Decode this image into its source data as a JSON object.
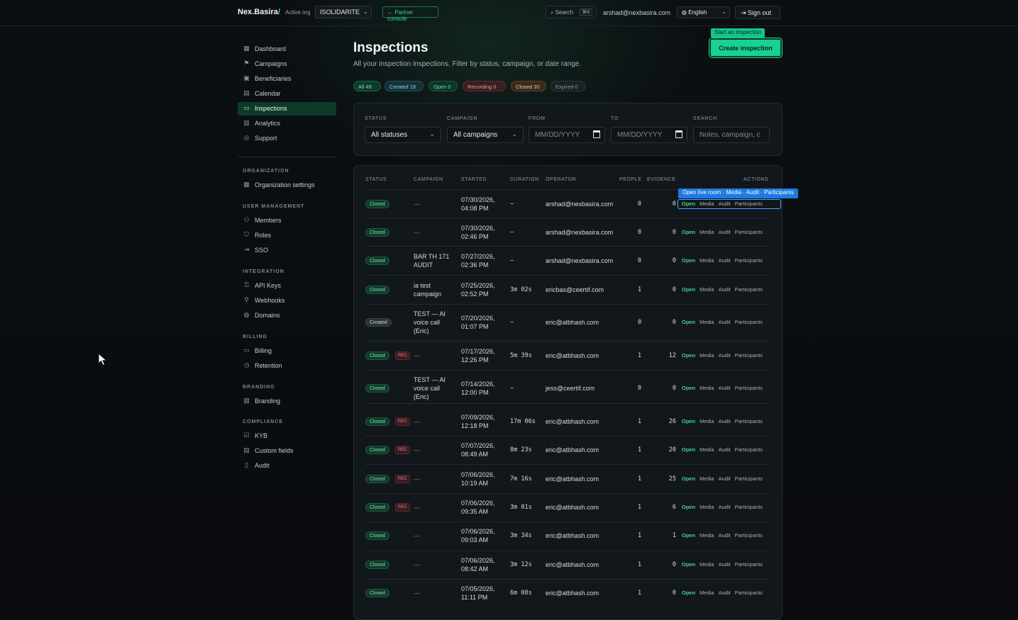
{
  "header": {
    "logo_text": "Nex.Basira",
    "logo_slash": "/",
    "active_org_label": "Active org",
    "org_name": "ISOLIDARITE",
    "partner_console": "← Partner console",
    "search_label": "Search",
    "search_kbd": "⌘K",
    "user_email": "arshad@nexbasira.com",
    "language": "English",
    "sign_out": "Sign out"
  },
  "sidebar": {
    "main": [
      {
        "label": "Dashboard",
        "icon": "dashboard-icon"
      },
      {
        "label": "Campaigns",
        "icon": "flag-icon"
      },
      {
        "label": "Beneficiaries",
        "icon": "id-card-icon"
      },
      {
        "label": "Calendar",
        "icon": "calendar-icon"
      },
      {
        "label": "Inspections",
        "icon": "video-icon",
        "active": true
      },
      {
        "label": "Analytics",
        "icon": "bar-chart-icon"
      },
      {
        "label": "Support",
        "icon": "life-buoy-icon"
      }
    ],
    "sections": [
      {
        "heading": "ORGANIZATION",
        "items": [
          "Organization settings"
        ]
      },
      {
        "heading": "USER MANAGEMENT",
        "items": [
          "Members",
          "Roles",
          "SSO"
        ]
      },
      {
        "heading": "INTEGRATION",
        "items": [
          "API Keys",
          "Webhooks",
          "Domains"
        ]
      },
      {
        "heading": "BILLING",
        "items": [
          "Billing",
          "Retention"
        ]
      },
      {
        "heading": "BRANDING",
        "items": [
          "Branding"
        ]
      },
      {
        "heading": "COMPLIANCE",
        "items": [
          "KYB",
          "Custom fields",
          "Audit"
        ]
      }
    ]
  },
  "page": {
    "title": "Inspections",
    "subtitle": "All your inspection inspections. Filter by status, campaign, or date range.",
    "start_tooltip": "Start an inspection",
    "create_button": "Create inspection"
  },
  "chips": [
    {
      "label": "All 49",
      "bg": "#0f3a29",
      "fg": "#7fe0b4",
      "border": "#1a6a48"
    },
    {
      "label": "Created 19",
      "bg": "#133238",
      "fg": "#8fd6e0",
      "border": "#235059"
    },
    {
      "label": "Open 0",
      "bg": "#0f3427",
      "fg": "#6fdcae",
      "border": "#1c5a41"
    },
    {
      "label": "Recording 0",
      "bg": "#3a1f20",
      "fg": "#e29a9a",
      "border": "#5a2e30"
    },
    {
      "label": "Closed 30",
      "bg": "#3a2a1a",
      "fg": "#e9c79a",
      "border": "#5a4228"
    },
    {
      "label": "Expired 0",
      "bg": "#1b2125",
      "fg": "#8c969e",
      "border": "#2c353c"
    }
  ],
  "filters": {
    "status_label": "STATUS",
    "status_value": "All statuses",
    "campaign_label": "CAMPAIGN",
    "campaign_value": "All campaigns",
    "from_label": "FROM",
    "from_placeholder": "MM/DD/YYYY",
    "to_label": "TO",
    "to_placeholder": "MM/DD/YYYY",
    "search_label": "SEARCH",
    "search_placeholder": "Notes, campaign, c"
  },
  "table": {
    "columns": [
      "STATUS",
      "CAMPAIGN",
      "STARTED",
      "DURATION",
      "OPERATOR",
      "PEOPLE",
      "EVIDENCE",
      "ACTIONS"
    ],
    "actions": [
      "Open",
      "Media",
      "Audit",
      "Participants"
    ],
    "focus_tooltip": "Open live room · Media · Audit · Participants",
    "rows": [
      {
        "status": "Closed",
        "rec": false,
        "campaign": [
          "—"
        ],
        "started": [
          "07/30/2026,",
          "04:08 PM"
        ],
        "duration": "—",
        "operator": "arshad@nexbasira.com",
        "people": "0",
        "evidence": "0"
      },
      {
        "status": "Closed",
        "rec": false,
        "campaign": [
          "—"
        ],
        "started": [
          "07/30/2026,",
          "02:46 PM"
        ],
        "duration": "—",
        "operator": "arshad@nexbasira.com",
        "people": "0",
        "evidence": "0"
      },
      {
        "status": "Closed",
        "rec": false,
        "campaign": [
          "BAR TH 171",
          "AUDIT"
        ],
        "started": [
          "07/27/2026,",
          "02:36 PM"
        ],
        "duration": "—",
        "operator": "arshad@nexbasira.com",
        "people": "0",
        "evidence": "0"
      },
      {
        "status": "Closed",
        "rec": false,
        "campaign": [
          "ia test",
          "campaign"
        ],
        "started": [
          "07/25/2026,",
          "02:52 PM"
        ],
        "duration": "3m 02s",
        "operator": "ericbas@ceertif.com",
        "people": "1",
        "evidence": "0"
      },
      {
        "status": "Created",
        "rec": false,
        "campaign": [
          "TEST — AI",
          "voice call",
          "(Eric)"
        ],
        "started": [
          "07/20/2026,",
          "01:07 PM"
        ],
        "duration": "—",
        "operator": "eric@atbhash.com",
        "people": "0",
        "evidence": "0"
      },
      {
        "status": "Closed",
        "rec": true,
        "campaign": [
          "—"
        ],
        "started": [
          "07/17/2026,",
          "12:26 PM"
        ],
        "duration": "5m 39s",
        "operator": "eric@atbhash.com",
        "people": "1",
        "evidence": "12"
      },
      {
        "status": "Closed",
        "rec": false,
        "campaign": [
          "TEST — AI",
          "voice call",
          "(Eric)"
        ],
        "started": [
          "07/14/2026,",
          "12:00 PM"
        ],
        "duration": "—",
        "operator": "jess@ceertif.com",
        "people": "0",
        "evidence": "0"
      },
      {
        "status": "Closed",
        "rec": true,
        "campaign": [
          "—"
        ],
        "started": [
          "07/09/2026,",
          "12:18 PM"
        ],
        "duration": "17m 06s",
        "operator": "eric@atbhash.com",
        "people": "1",
        "evidence": "26"
      },
      {
        "status": "Closed",
        "rec": true,
        "campaign": [
          "—"
        ],
        "started": [
          "07/07/2026,",
          "08:49 AM"
        ],
        "duration": "8m 23s",
        "operator": "eric@atbhash.com",
        "people": "1",
        "evidence": "20"
      },
      {
        "status": "Closed",
        "rec": true,
        "campaign": [
          "—"
        ],
        "started": [
          "07/06/2026,",
          "10:19 AM"
        ],
        "duration": "7m 16s",
        "operator": "eric@atbhash.com",
        "people": "1",
        "evidence": "25"
      },
      {
        "status": "Closed",
        "rec": true,
        "campaign": [
          "—"
        ],
        "started": [
          "07/06/2026,",
          "09:35 AM"
        ],
        "duration": "3m 01s",
        "operator": "eric@atbhash.com",
        "people": "1",
        "evidence": "6"
      },
      {
        "status": "Closed",
        "rec": false,
        "campaign": [
          "—"
        ],
        "started": [
          "07/06/2026,",
          "09:03 AM"
        ],
        "duration": "3m 34s",
        "operator": "eric@atbhash.com",
        "people": "1",
        "evidence": "1"
      },
      {
        "status": "Closed",
        "rec": false,
        "campaign": [
          "—"
        ],
        "started": [
          "07/06/2026,",
          "08:42 AM"
        ],
        "duration": "3m 12s",
        "operator": "eric@atbhash.com",
        "people": "1",
        "evidence": "0"
      },
      {
        "status": "Closed",
        "rec": false,
        "campaign": [
          "—"
        ],
        "started": [
          "07/05/2026,",
          "11:11 PM"
        ],
        "duration": "6m 08s",
        "operator": "eric@atbhash.com",
        "people": "1",
        "evidence": "0"
      }
    ],
    "rec_label": "REC"
  }
}
